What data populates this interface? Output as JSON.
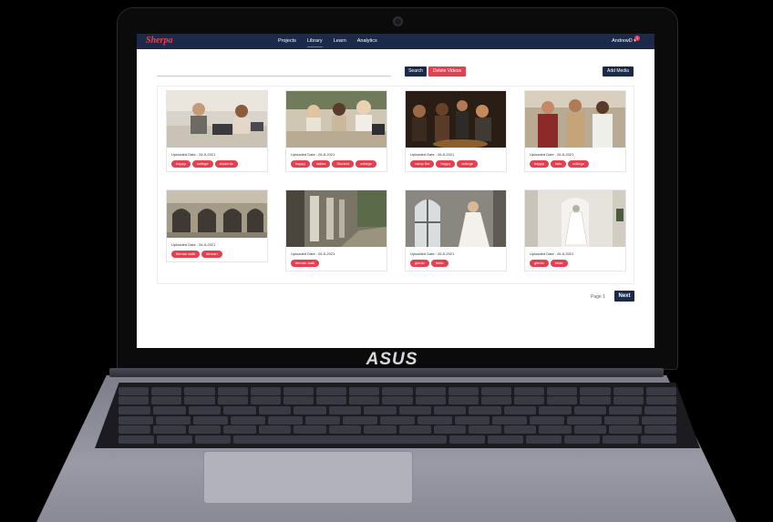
{
  "device": {
    "brand": "ASUS"
  },
  "app": {
    "logo": "Sherpa",
    "nav": [
      "Projects",
      "Library",
      "Learn",
      "Analytics"
    ],
    "active_nav": "Library",
    "user": "AndrewD ▾",
    "notification_count": "1"
  },
  "toolbar": {
    "search_value": "",
    "search_placeholder": "",
    "search_label": "Search",
    "delete_label": "Delete Videos",
    "add_label": "Add Media"
  },
  "cards": [
    {
      "date": "Uploaded Date : 26-5-2021",
      "tags": [
        "happy",
        "college",
        "students"
      ]
    },
    {
      "date": "Uploaded Date : 26-5-2021",
      "tags": [
        "happy",
        "ladies",
        "Student",
        "college"
      ]
    },
    {
      "date": "Uploaded Date : 26-5-2021",
      "tags": [
        "camp fire",
        "happy",
        "college"
      ]
    },
    {
      "date": "Uploaded Date : 26-5-2021",
      "tags": [
        "happy",
        "lads",
        "college"
      ]
    },
    {
      "date": "Uploaded Date : 26-5-2021",
      "tags": [
        "tiernan walk",
        "tiernan"
      ]
    },
    {
      "date": "Uploaded Date : 26-5-2021",
      "tags": [
        "tiernan walk"
      ]
    },
    {
      "date": "Uploaded Date : 26-5-2021",
      "tags": [
        "glenlo",
        "bride"
      ]
    },
    {
      "date": "Uploaded Date : 26-5-2021",
      "tags": [
        "glenlo",
        "bride"
      ]
    }
  ],
  "pagination": {
    "page_label": "Page 1",
    "next_label": "Next"
  },
  "colors": {
    "navy": "#1b2a4a",
    "accent": "#e5404f"
  }
}
